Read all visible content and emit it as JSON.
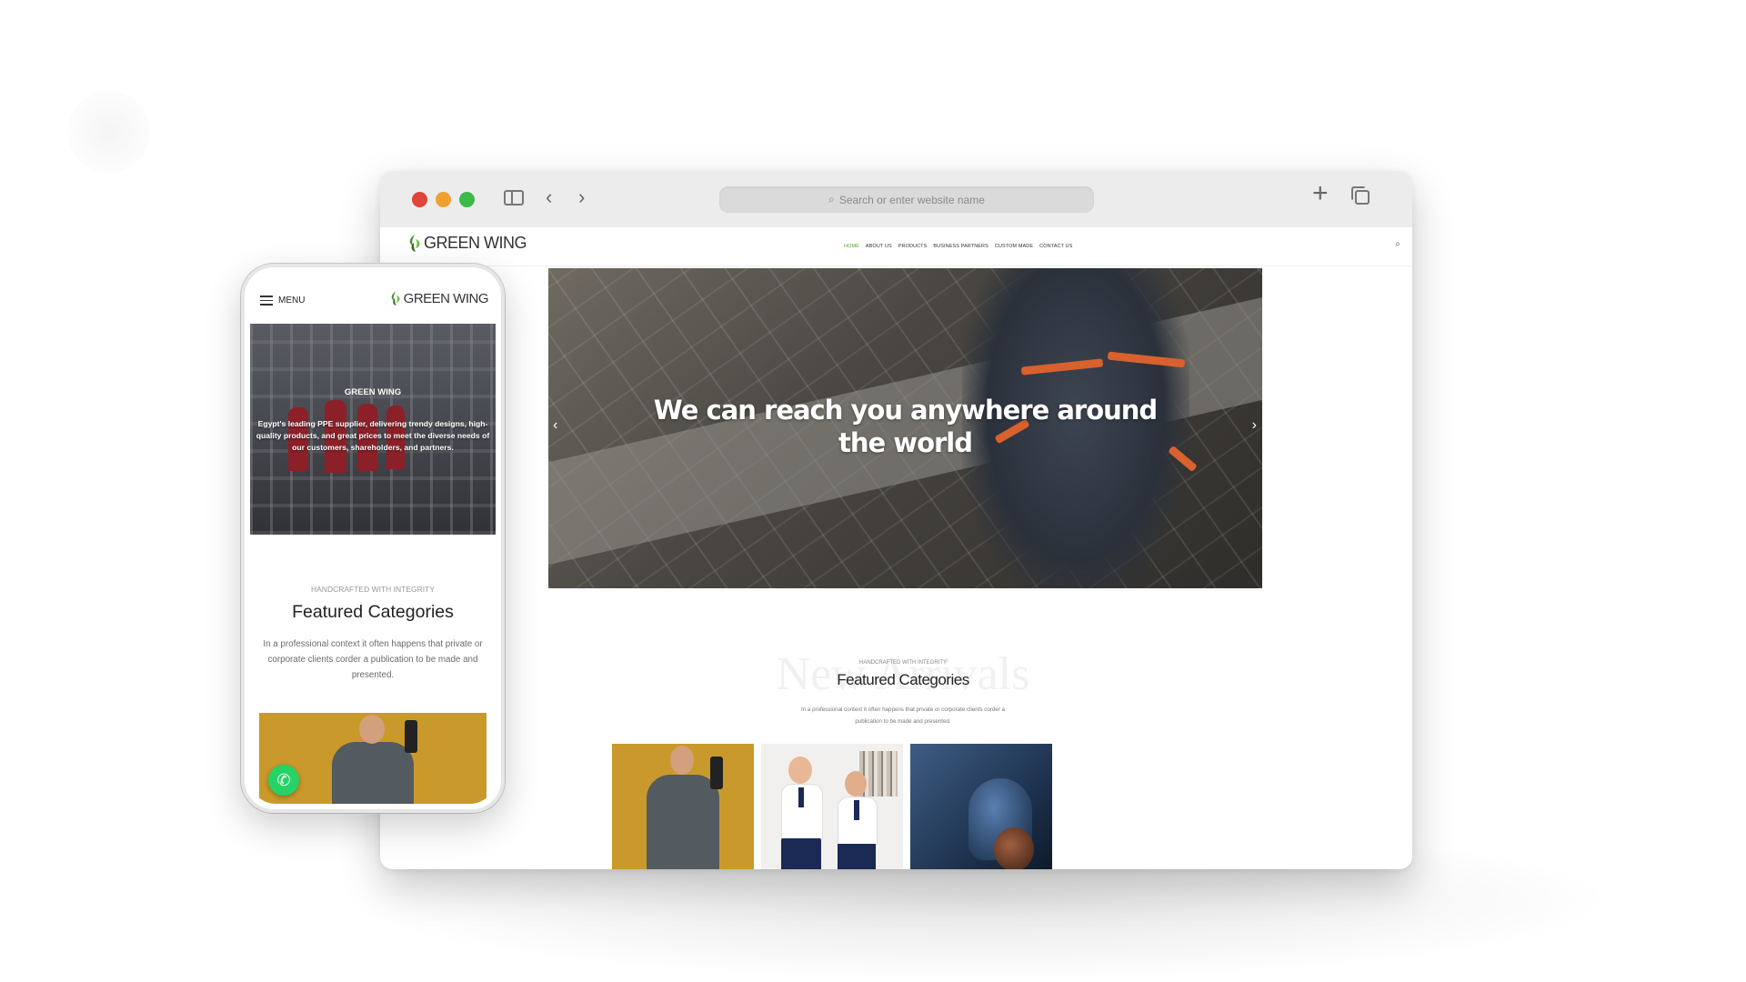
{
  "browser": {
    "address_placeholder": "Search or enter website name"
  },
  "site": {
    "brand": "GREEN WING",
    "nav": [
      "HOME",
      "ABOUT US",
      "PRODUCTS",
      "BUSINESS PARTNERS",
      "CUSTOM MADE",
      "CONTACT US"
    ],
    "active_nav": "HOME",
    "accent_color": "#5aa52e"
  },
  "hero": {
    "title_line1": "We can reach you anywhere around",
    "title_line2": "the world",
    "prev_arrow": "‹",
    "next_arrow": "›"
  },
  "featured": {
    "watermark": "New Arrivals",
    "eyebrow": "HANDCRAFTED WITH INTEGRITY",
    "title": "Featured Categories",
    "description_line1": "In a professional context it often happens that private or corporate clients corder a",
    "description_line2": "publication to be made and presented."
  },
  "phone": {
    "menu_label": "MENU",
    "brand": "GREEN WING",
    "hero_brand": "GREEN WING",
    "hero_text": "Egypt's leading PPE supplier, delivering trendy designs, high-quality products, and great prices to meet the diverse needs of our customers, shareholders, and partners.",
    "eyebrow": "HANDCRAFTED WITH INTEGRITY",
    "title": "Featured Categories",
    "description": "In a professional context it often happens that private or corporate clients corder a publication to be made and presented."
  },
  "icons": {
    "search": "search-icon",
    "whatsapp": "whatsapp-icon",
    "menu": "hamburger-menu-icon"
  }
}
